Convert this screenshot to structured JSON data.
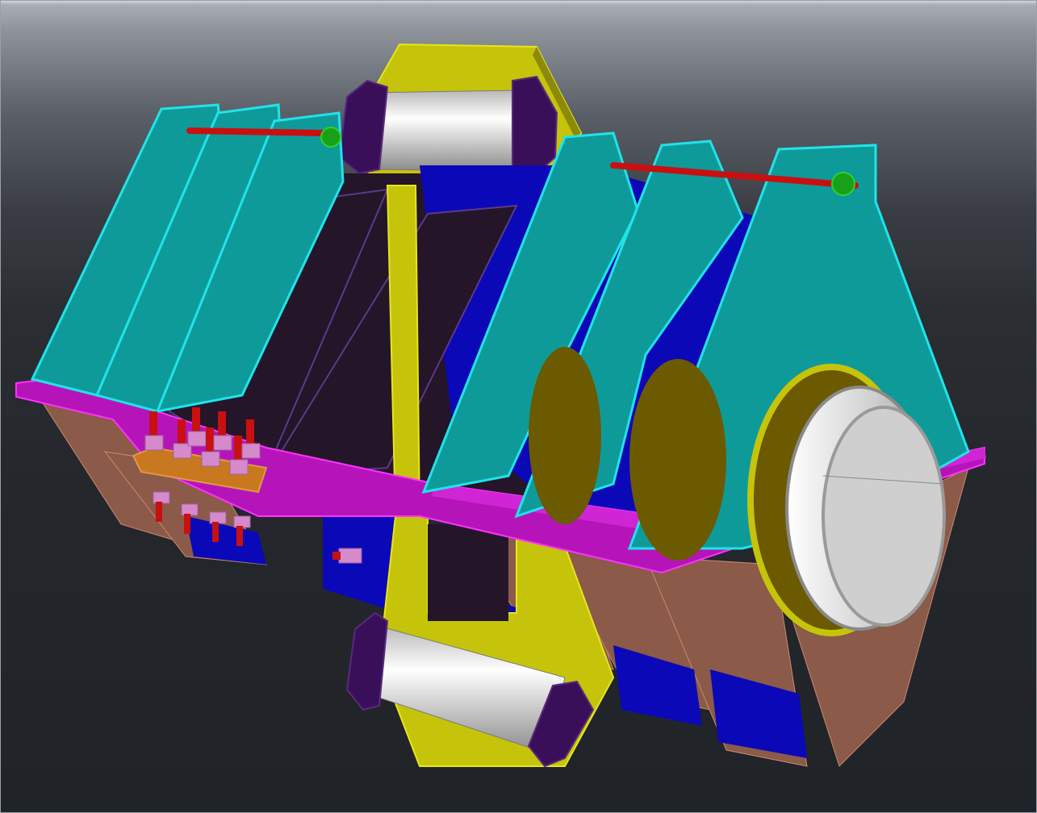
{
  "viewport": {
    "background": "3d-gradient-dark",
    "render_mode": "shaded-with-edges"
  },
  "colors": {
    "lifting_lug": "#0f9a9a",
    "lug_edge": "#21e3ea",
    "base_plate": "#b515b8",
    "base_plate_edge": "#ff33ff",
    "frame_yellow": "#c6c40a",
    "frame_yellow_light": "#e6e61a",
    "trunnion_pipe": "#d8d8d8",
    "pipe_cap": "#3a0f5a",
    "side_panel_blue": "#0b08b8",
    "dark_body": "#241528",
    "gusset_brown": "#8b5a48",
    "ring_olive": "#6b5a00",
    "bolt_red": "#c81010",
    "nut_pink": "#d48acb",
    "splice_plate_orange": "#c8781e",
    "pin_green": "#18a018"
  },
  "parts": [
    "lifting-lug",
    "base-plate",
    "trunnion-pipe",
    "frame-plate",
    "side-panel",
    "gusset",
    "end-ring",
    "bolt",
    "nut",
    "splice-plate",
    "lug-pin"
  ]
}
